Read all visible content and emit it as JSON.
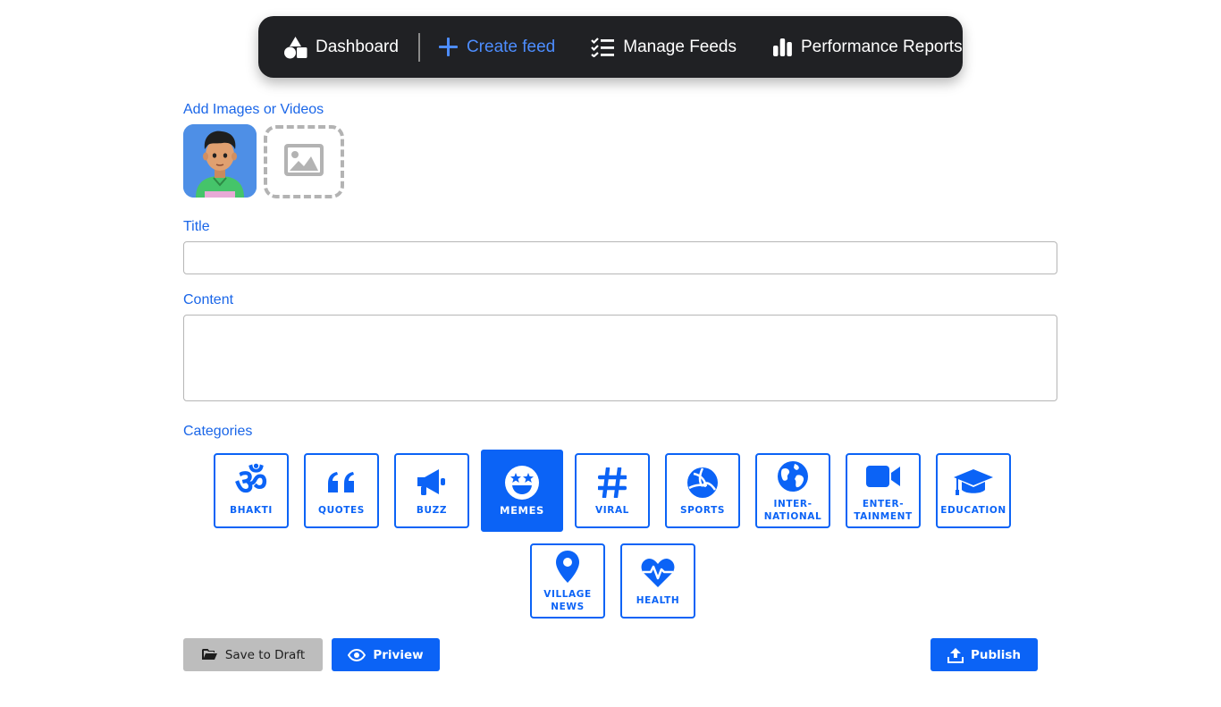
{
  "nav": {
    "items": [
      {
        "label": "Dashboard",
        "icon": "shapes-icon"
      },
      {
        "label": "Create feed",
        "icon": "plus-icon",
        "active": true
      },
      {
        "label": "Manage Feeds",
        "icon": "checklist-icon"
      },
      {
        "label": "Performance Reports",
        "icon": "bar-chart-icon"
      }
    ],
    "active_color": "#4d8dff"
  },
  "media": {
    "label": "Add Images or Videos",
    "items": [
      "avatar-image"
    ],
    "add_icon": "image-placeholder-icon"
  },
  "form": {
    "title_label": "Title",
    "title_value": "",
    "content_label": "Content",
    "content_value": ""
  },
  "categories": {
    "label": "Categories",
    "selected": "MEMES",
    "items": [
      {
        "label": "BHAKTI",
        "icon": "om-icon"
      },
      {
        "label": "QUOTES",
        "icon": "quote-icon"
      },
      {
        "label": "BUZZ",
        "icon": "megaphone-icon"
      },
      {
        "label": "MEMES",
        "icon": "smile-icon"
      },
      {
        "label": "VIRAL",
        "icon": "hashtag-icon"
      },
      {
        "label": "SPORTS",
        "icon": "volleyball-icon"
      },
      {
        "label": "INTER-\nNATIONAL",
        "icon": "globe-icon"
      },
      {
        "label": "ENTER-\nTAINMENT",
        "icon": "video-icon"
      },
      {
        "label": "EDUCATION",
        "icon": "graduation-cap-icon"
      },
      {
        "label": "VILLAGE\nNEWS",
        "icon": "map-pin-icon"
      },
      {
        "label": "HEALTH",
        "icon": "heart-pulse-icon"
      }
    ]
  },
  "actions": {
    "save_draft": "Save to Draft",
    "preview": "Priview",
    "publish": "Publish"
  },
  "colors": {
    "primary": "#0b63f6",
    "nav_bg": "#202124",
    "label": "#1a66e8",
    "draft_bg": "#bdbdbd"
  }
}
